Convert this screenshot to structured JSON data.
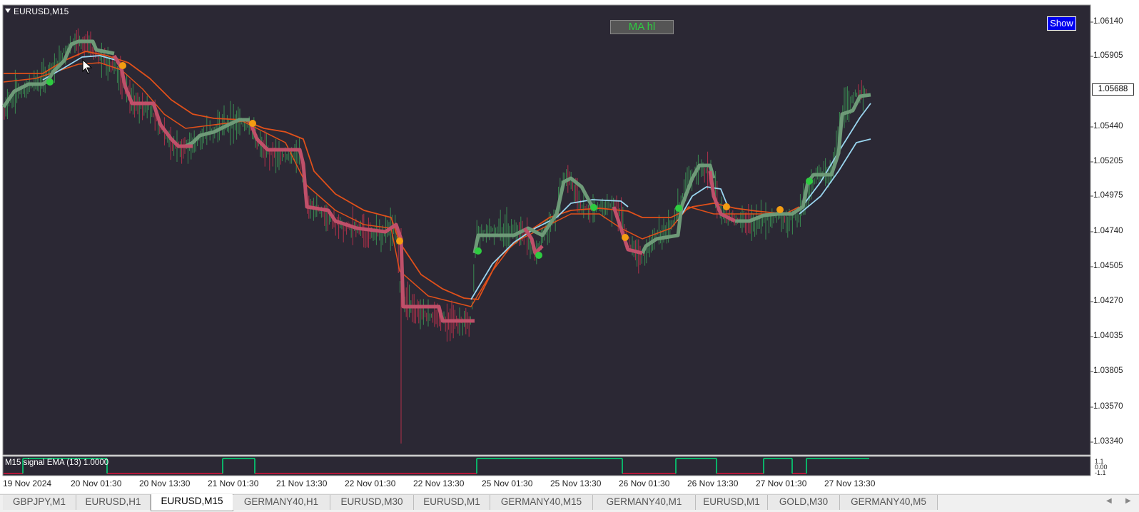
{
  "chart": {
    "symbol": "EURUSD,M15",
    "ma_label": "MA hl",
    "show_button": "Show",
    "current_price": "1.05688",
    "price_levels": [
      "1.06140",
      "1.05905",
      "1.05440",
      "1.05205",
      "1.04975",
      "1.04740",
      "1.04505",
      "1.04270",
      "1.04035",
      "1.03805",
      "1.03570",
      "1.03340"
    ],
    "time_labels": [
      "19 Nov 2024",
      "20 Nov 01:30",
      "20 Nov 13:30",
      "21 Nov 01:30",
      "21 Nov 13:30",
      "22 Nov 01:30",
      "22 Nov 13:30",
      "25 Nov 01:30",
      "25 Nov 13:30",
      "26 Nov 01:30",
      "26 Nov 13:30",
      "27 Nov 01:30",
      "27 Nov 13:30"
    ],
    "colors": {
      "background": "#2b2834",
      "bull_bar": "#3a8a52",
      "bear_bar": "#b0304a",
      "ma_step_up": "#6e9a78",
      "ma_step_down": "#c0506a",
      "ema_orange": "#e0501a",
      "ema_light_blue": "#9ad6f0",
      "signal_green": "#00e07a",
      "signal_red": "#e0103a"
    }
  },
  "indicator": {
    "label": "M15 signal EMA (13) 1.0000",
    "scale_top": "1.1",
    "scale_mid": "0.00",
    "scale_bottom": "-1.1"
  },
  "tabs": [
    {
      "label": "GBPJPY,M1",
      "active": false
    },
    {
      "label": "EURUSD,H1",
      "active": false
    },
    {
      "label": "EURUSD,M15",
      "active": true
    },
    {
      "label": "GERMANY40,H1",
      "active": false
    },
    {
      "label": "EURUSD,M30",
      "active": false
    },
    {
      "label": "EURUSD,M1",
      "active": false
    },
    {
      "label": "GERMANY40,M15",
      "active": false
    },
    {
      "label": "GERMANY40,M1",
      "active": false
    },
    {
      "label": "EURUSD,M1",
      "active": false
    },
    {
      "label": "GOLD,M30",
      "active": false
    },
    {
      "label": "GERMANY40,M5",
      "active": false
    }
  ],
  "icons": {
    "symbol_dropdown": "triangle-down-icon",
    "cursor": "mouse-pointer-icon",
    "scroll_left": "arrow-left-icon",
    "scroll_right": "arrow-right-icon"
  }
}
